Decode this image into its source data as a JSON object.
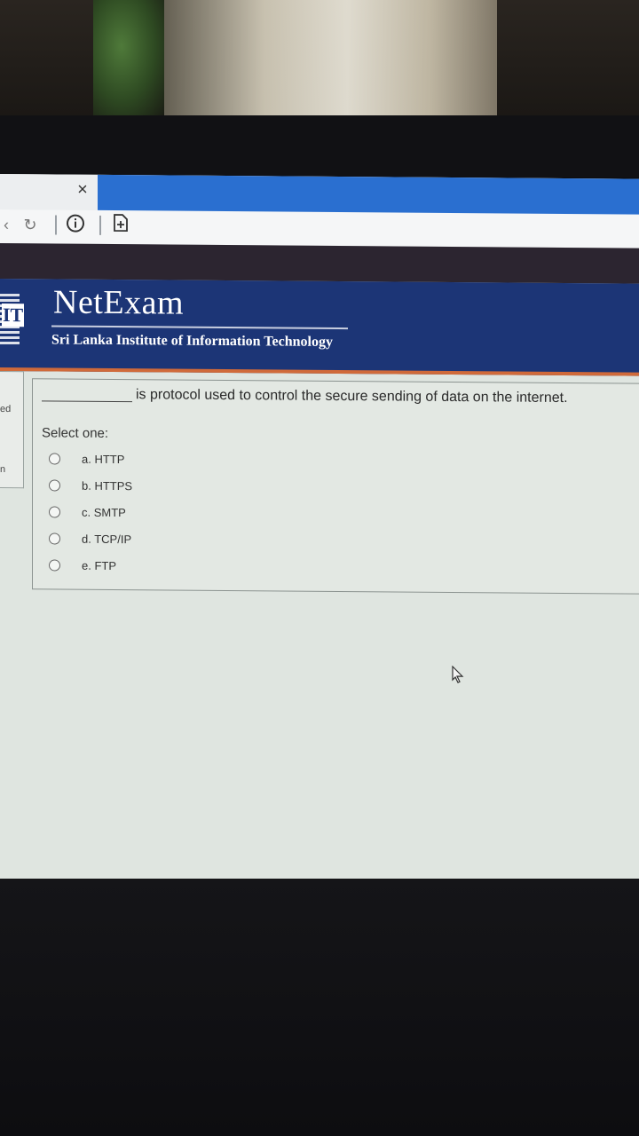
{
  "browser": {
    "tab_close": "×",
    "icons": [
      "refresh-icon",
      "info-icon",
      "document-icon"
    ]
  },
  "header": {
    "brand": "NetExam",
    "subtitle": "Sri Lanka Institute of Information Technology",
    "logo_text": "IT"
  },
  "sidebar": {
    "fragments": [
      "ed",
      "n"
    ]
  },
  "question": {
    "text": "is protocol used to control the secure sending of data on the internet.",
    "prompt": "Select one:",
    "options": [
      {
        "label": "a. HTTP",
        "selected": false
      },
      {
        "label": "b. HTTPS",
        "selected": false
      },
      {
        "label": "c. SMTP",
        "selected": false
      },
      {
        "label": "d. TCP/IP",
        "selected": false
      },
      {
        "label": "e. FTP",
        "selected": false
      }
    ]
  },
  "colors": {
    "header_bg": "#1c3576",
    "header_accent": "#d06a3a",
    "tab_active": "#2a6fd0"
  }
}
